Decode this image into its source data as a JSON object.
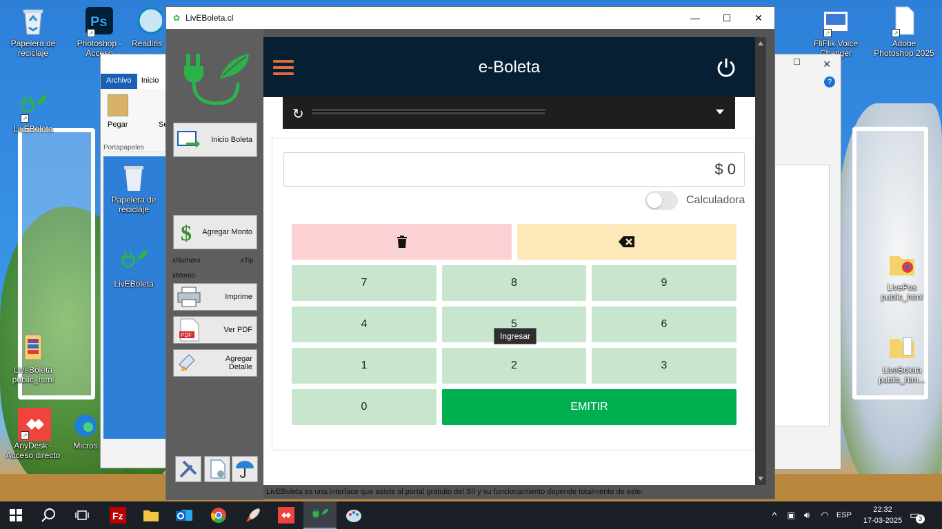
{
  "desktop": {
    "icons": [
      {
        "label": "Papelera de reciclaje"
      },
      {
        "label": "Photoshop - Acceso"
      },
      {
        "label": "Readiris"
      },
      {
        "label": "LivEBoleta"
      },
      {
        "label": "LiveBoleta public_html"
      },
      {
        "label": "AnyDesk - Acceso directo"
      },
      {
        "label": "Micros"
      },
      {
        "label": "FliFlik Voice Changer"
      },
      {
        "label": "Adobe Photoshop 2025"
      },
      {
        "label": "LivePos public_html"
      },
      {
        "label": "LiveBoleta public_htm..."
      },
      {
        "label": "Papelera de reciclaje"
      },
      {
        "label": "LivEBoleta"
      }
    ],
    "bg_explorer": {
      "tabs": [
        "Archivo",
        "Inicio"
      ],
      "paste": "Pegar",
      "group": "Portapapeles",
      "sel": "Se"
    }
  },
  "window": {
    "title": "LivEBoleta.cl",
    "minimize": "—",
    "maximize": "☐",
    "close": "✕"
  },
  "sidebar": {
    "buttons": [
      {
        "label": "Inicio Boleta",
        "icon": "login-icon"
      },
      {
        "label": "Agregar Monto",
        "icon": "dollar-icon"
      },
      {
        "label": "Imprime",
        "icon": "printer-icon"
      },
      {
        "label": "Ver PDF",
        "icon": "pdf-icon"
      },
      {
        "label": "Agregar Detalle",
        "icon": "edit-detail-icon"
      }
    ],
    "xnumero": "xNumero",
    "xtip": "xTip",
    "xmonto": "xMonto",
    "tools": [
      "tools-icon",
      "document-settings-icon",
      "umbrella-icon"
    ]
  },
  "header": {
    "title": "e-Boleta"
  },
  "amount": "$ 0",
  "calc_toggle": {
    "label": "Calculadora",
    "on": false
  },
  "keypad": {
    "keys": [
      "7",
      "8",
      "9",
      "4",
      "5",
      "6",
      "1",
      "2",
      "3",
      "0"
    ],
    "emit": "EMITIR"
  },
  "tooltip": "Ingresar",
  "footer": "LivEBoleta es una interface que asiste al portal gratuito del SII y su funcionamiento depende totalmente de este.",
  "taskbar": {
    "lang": "ESP",
    "time": "22:32",
    "date": "17-03-2025",
    "notifications": "3"
  },
  "colors": {
    "header": "#071f33",
    "accent": "#e06a3c",
    "emit": "#00b050",
    "key": "#c7e6cd",
    "delete": "#fcd1d3",
    "backspace": "#fde9b7"
  }
}
